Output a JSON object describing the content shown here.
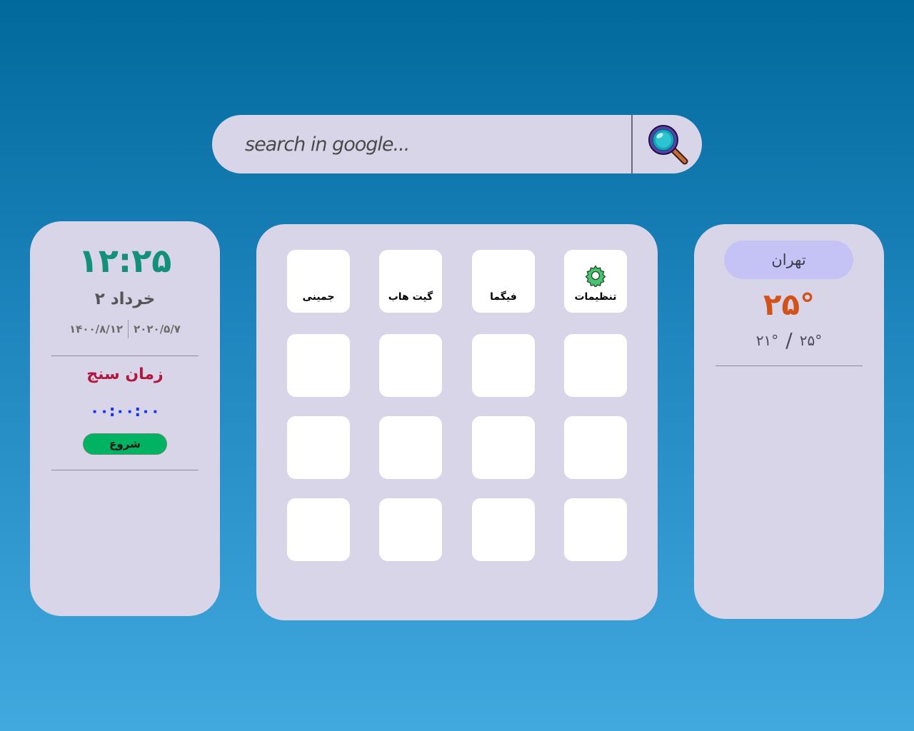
{
  "search": {
    "placeholder": "search in google...",
    "button_icon": "magnifier-icon"
  },
  "clock": {
    "time": "۱۲:۲۵",
    "date_persian": "۲ خرداد",
    "date_gregorian": "۲۰۲۰/۵/۷",
    "date_solar": "۱۴۰۰/۸/۱۲"
  },
  "stopwatch": {
    "title": "زمان سنج",
    "display": "۰۰:۰۰:۰۰",
    "start_label": "شروع"
  },
  "shortcuts": [
    {
      "label": "تنظیمات",
      "icon": "gear-icon"
    },
    {
      "label": "فیگما"
    },
    {
      "label": "گیت هاب"
    },
    {
      "label": "جمینی"
    },
    {
      "label": ""
    },
    {
      "label": ""
    },
    {
      "label": ""
    },
    {
      "label": ""
    },
    {
      "label": ""
    },
    {
      "label": ""
    },
    {
      "label": ""
    },
    {
      "label": ""
    },
    {
      "label": ""
    },
    {
      "label": ""
    },
    {
      "label": ""
    },
    {
      "label": ""
    }
  ],
  "weather": {
    "city": "تهران",
    "temperature": "۲۵°",
    "high": "۲۵°",
    "low": "۲۱°",
    "range_separator": "/"
  },
  "colors": {
    "panel": "#d9d5e8",
    "clock": "#129079",
    "timer_title": "#b2183f",
    "timer_digits": "#1131ff",
    "start_button": "#00b362",
    "temperature": "#d2521a",
    "city_pill": "#c5c3f5"
  }
}
